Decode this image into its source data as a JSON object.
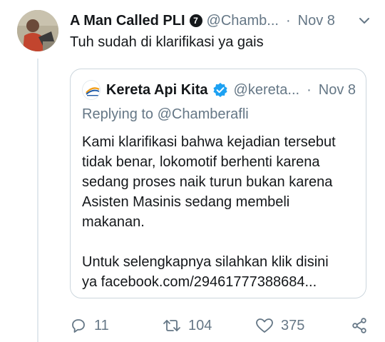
{
  "tweet": {
    "author_name": "A Man Called PLI",
    "badge_glyph": "7",
    "handle": "@Chamb...",
    "separator": "·",
    "date": "Nov 8",
    "text": "Tuh sudah di klarifikasi ya gais"
  },
  "quote": {
    "name": "Kereta Api Kita",
    "handle": "@kereta...",
    "separator": "·",
    "date": "Nov 8",
    "replying_to": "Replying to @Chamberafli",
    "body_lines": [
      "Kami klarifikasi bahwa kejadian tersebut",
      "tidak benar, lokomotif berhenti karena",
      "sedang proses naik turun bukan karena",
      "Asisten Masinis sedang membeli",
      "makanan."
    ],
    "body_lines_2": [
      "Untuk selengkapnya silahkan klik disini",
      "ya facebook.com/29461777388684..."
    ]
  },
  "actions": {
    "replies": "11",
    "retweets": "104",
    "likes": "375"
  },
  "icons": {
    "reply": "comment-icon",
    "retweet": "retweet-icon",
    "like": "heart-icon",
    "share": "share-icon",
    "more": "chevron-down-icon",
    "verified": "verified-badge-icon"
  },
  "colors": {
    "text": "#14171a",
    "muted": "#657786",
    "verified": "#1da1f2",
    "border": "#ccd6dd"
  }
}
